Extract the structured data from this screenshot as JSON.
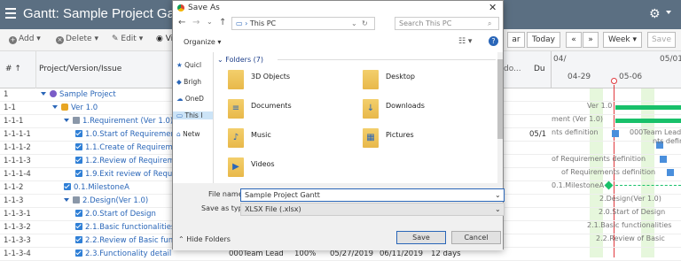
{
  "app": {
    "title": "Gantt:  Sample Project Gantt"
  },
  "toolbar": {
    "add": "Add",
    "delete": "Delete",
    "edit": "Edit",
    "view": "Vi",
    "today": "Today",
    "prev": "«",
    "next": "»",
    "week": "Week",
    "save": "Save",
    "calendar": "ar"
  },
  "columns": {
    "num": "#",
    "num_sort": "↑",
    "issue": "Project/Version/Issue",
    "due": "Du",
    "done": "do...",
    "week_label": "04/",
    "month_label": "05/01",
    "day1": "04-29",
    "day2": "05-06"
  },
  "rows": [
    {
      "num": "1",
      "name": "Sample Project"
    },
    {
      "num": "1-1",
      "name": "Ver 1.0"
    },
    {
      "num": "1-1-1",
      "name": "1.Requirement (Ver 1.0)"
    },
    {
      "num": "1-1-1-1",
      "name": "1.0.Start of Requirement"
    },
    {
      "num": "1-1-1-2",
      "name": "1.1.Create of Requireme"
    },
    {
      "num": "1-1-1-3",
      "name": "1.2.Review of Requireme"
    },
    {
      "num": "1-1-1-4",
      "name": "1.9.Exit review of Requir"
    },
    {
      "num": "1-1-2",
      "name": "0.1.MilestoneA"
    },
    {
      "num": "1-1-3",
      "name": "2.Design(Ver 1.0)"
    },
    {
      "num": "1-1-3-1",
      "name": "2.0.Start of Design"
    },
    {
      "num": "1-1-3-2",
      "name": "2.1.Basic functionalities"
    },
    {
      "num": "1-1-3-3",
      "name": "2.2.Review of Basic fund"
    },
    {
      "num": "1-1-3-4",
      "name": "2.3.Functionality detail"
    }
  ],
  "last_row": {
    "assignee": "000Team Lead",
    "progress": "100%",
    "start": "05/27/2019",
    "end": "06/11/2019",
    "duration": "12 days"
  },
  "due_cell": "05/1",
  "gantt_labels": [
    "Ver 1.0",
    "ment (Ver 1.0)",
    "nts definition",
    "000Team Lead",
    "nts definition",
    "of Requirements definition",
    "of Requirements definition",
    "0.1.MilestoneA",
    "2.Design(Ver 1.0)",
    "2.0.Start of Design",
    "2.1.Basic functionalities",
    "2.2.Review of Basic"
  ],
  "dialog": {
    "title": "Save As",
    "path": "This PC",
    "search_placeholder": "Search This PC",
    "organize": "Organize",
    "folders_header": "Folders (7)",
    "nav": [
      "Quicl",
      "Brigh",
      "OneD",
      "This I",
      "Netw"
    ],
    "folders": [
      "3D Objects",
      "Desktop",
      "Documents",
      "Downloads",
      "Music",
      "Pictures",
      "Videos"
    ],
    "file_name_label": "File name:",
    "file_name_value": "Sample Project Gantt",
    "save_type_label": "Save as type:",
    "save_type_value": "XLSX File (.xlsx)",
    "hide_folders": "Hide Folders",
    "save": "Save",
    "cancel": "Cancel"
  },
  "colors": {
    "titlebar": "#5b6f82",
    "accent": "#2a66b8",
    "bar": "#19c06a",
    "folder": "#e8b84a"
  }
}
